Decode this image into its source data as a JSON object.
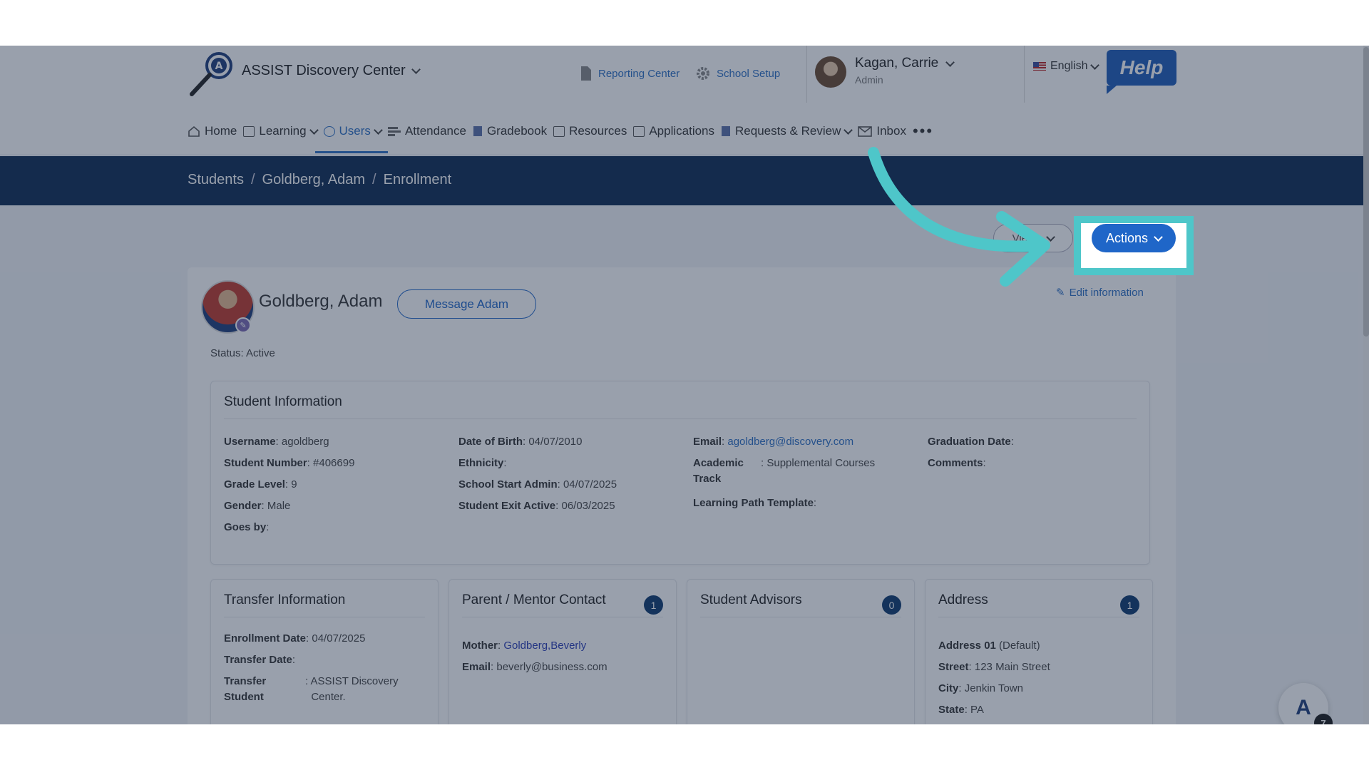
{
  "header": {
    "app_title": "ASSIST Discovery Center",
    "links": [
      {
        "label": "Reporting Center",
        "icon": "document-icon"
      },
      {
        "label": "School Setup",
        "icon": "gear-icon"
      }
    ],
    "user": {
      "name": "Kagan, Carrie",
      "role": "Admin"
    },
    "language": "English",
    "help_label": "Help"
  },
  "nav": {
    "items": [
      {
        "label": "Home",
        "icon": "home-icon"
      },
      {
        "label": "Learning",
        "icon": "grid-icon",
        "dropdown": true
      },
      {
        "label": "Users",
        "icon": "user-icon",
        "dropdown": true,
        "active": true
      },
      {
        "label": "Attendance",
        "icon": "list-icon"
      },
      {
        "label": "Gradebook",
        "icon": "book-icon"
      },
      {
        "label": "Resources",
        "icon": "monitor-icon"
      },
      {
        "label": "Applications",
        "icon": "chat-icon"
      },
      {
        "label": "Requests & Review",
        "icon": "clipboard-icon",
        "dropdown": true
      },
      {
        "label": "Inbox",
        "icon": "mail-icon"
      }
    ],
    "more": "•••"
  },
  "breadcrumb": [
    "Students",
    "Goldberg, Adam",
    "Enrollment"
  ],
  "toolbar": {
    "views_label": "Views",
    "actions_label": "Actions"
  },
  "student": {
    "name": "Goldberg, Adam",
    "message_label": "Message Adam",
    "edit_label": "Edit information",
    "status": "Status: Active"
  },
  "student_info": {
    "title": "Student Information",
    "col1": [
      {
        "label": "Username",
        "value": "agoldberg"
      },
      {
        "label": "Student Number",
        "value": "#406699"
      },
      {
        "label": "Grade Level",
        "value": "9"
      },
      {
        "label": "Gender",
        "value": "Male"
      },
      {
        "label": "Goes by",
        "value": ""
      }
    ],
    "col2": [
      {
        "label": "Date of Birth",
        "value": "04/07/2010"
      },
      {
        "label": "Ethnicity",
        "value": ""
      },
      {
        "label": "School Start Admin",
        "value": "04/07/2025"
      },
      {
        "label": "Student Exit Active",
        "value": "06/03/2025"
      }
    ],
    "email_label": "Email",
    "email_value": "agoldberg@discovery.com",
    "academic_label_1": "Academic",
    "academic_label_2": "Track",
    "academic_value": "Supplemental Courses",
    "lpt_label": "Learning Path Template",
    "col4": [
      {
        "label": "Graduation Date",
        "value": ""
      },
      {
        "label": "Comments",
        "value": ""
      }
    ]
  },
  "transfer": {
    "title": "Transfer Information",
    "enrollment_label": "Enrollment Date",
    "enrollment_value": "04/07/2025",
    "transfer_date_label": "Transfer Date",
    "transfer_student_label_1": "Transfer",
    "transfer_student_label_2": "Student",
    "transfer_student_value_1": "ASSIST Discovery",
    "transfer_student_value_2": "Center."
  },
  "parent": {
    "title": "Parent / Mentor Contact",
    "count": "1",
    "mother_label": "Mother",
    "mother_value": "Goldberg,Beverly",
    "email_label": "Email",
    "email_value": "beverly@business.com"
  },
  "advisors": {
    "title": "Student Advisors",
    "count": "0"
  },
  "address": {
    "title": "Address",
    "count": "1",
    "address_label": "Address 01",
    "address_value": "(Default)",
    "street_label": "Street",
    "street_value": "123 Main Street",
    "city_label": "City",
    "city_value": "Jenkin Town",
    "state_label": "State",
    "state_value": "PA"
  },
  "fab": {
    "badge": "7"
  },
  "colors": {
    "accent": "#1f66c8",
    "crumbbar": "#0d2b52",
    "highlight": "#4ec6c9"
  }
}
